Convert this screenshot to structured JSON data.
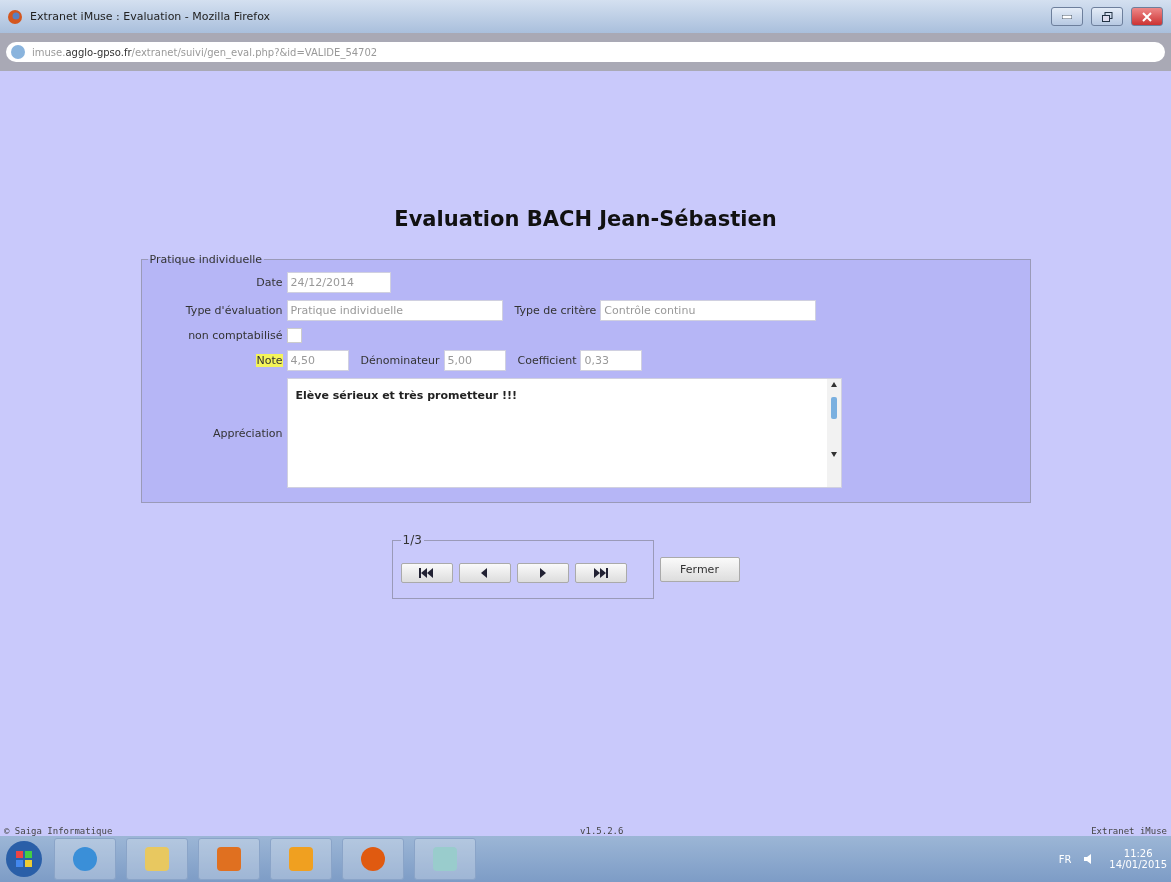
{
  "window": {
    "title": "Extranet iMuse : Evaluation - Mozilla Firefox"
  },
  "address_bar": {
    "url": "imuse.**agglo-gpso.fr**/extranet/suivi/gen_eval.php?&id=VALIDE_54702"
  },
  "page": {
    "heading": "Evaluation BACH Jean-Sébastien"
  },
  "form": {
    "legend": "Pratique individuelle",
    "rows": [
      {
        "fields": [
          {
            "kind": "date",
            "label": "Date",
            "value": "24/12/2014",
            "highlighted": false,
            "disabled": true
          }
        ]
      },
      {
        "fields": [
          {
            "kind": "text",
            "label": "Type d'évaluation",
            "value": "Pratique individuelle",
            "highlighted": false,
            "disabled": true
          },
          {
            "kind": "text",
            "label": "Type de critère",
            "value": "Contrôle continu",
            "highlighted": false,
            "disabled": true
          }
        ]
      },
      {
        "fields": [
          {
            "kind": "checkbox",
            "label": "non comptabilisé",
            "checked": false,
            "highlighted": false
          }
        ]
      },
      {
        "fields": [
          {
            "kind": "number",
            "label": "Note",
            "value": "4,50",
            "highlighted": true,
            "disabled": true
          },
          {
            "kind": "number",
            "label": "Dénominateur",
            "value": "5,00",
            "highlighted": false,
            "disabled": true
          },
          {
            "kind": "number",
            "label": "Coefficient",
            "value": "0,33",
            "highlighted": false,
            "disabled": true
          }
        ]
      },
      {
        "fields": [
          {
            "kind": "textarea",
            "label": "Appréciation",
            "value": "Elève sérieux et très prometteur !!!",
            "highlighted": false
          }
        ]
      }
    ]
  },
  "navigation": {
    "counter": "1/3",
    "buttons": [
      {
        "kind": "first"
      },
      {
        "kind": "prev"
      },
      {
        "kind": "next"
      },
      {
        "kind": "last"
      }
    ]
  },
  "close_button": "Fermer",
  "footer": {
    "left": "© Saiga Informatique",
    "center": "v1.5.2.6",
    "right": "Extranet iMuse"
  },
  "taskbar": {
    "apps": [
      {
        "kind": "ie"
      },
      {
        "kind": "explorer"
      },
      {
        "kind": "media"
      },
      {
        "kind": "outlook"
      },
      {
        "kind": "firefox"
      },
      {
        "kind": "paint"
      }
    ],
    "language": "FR",
    "time": "11:26",
    "date": "14/01/2015"
  }
}
